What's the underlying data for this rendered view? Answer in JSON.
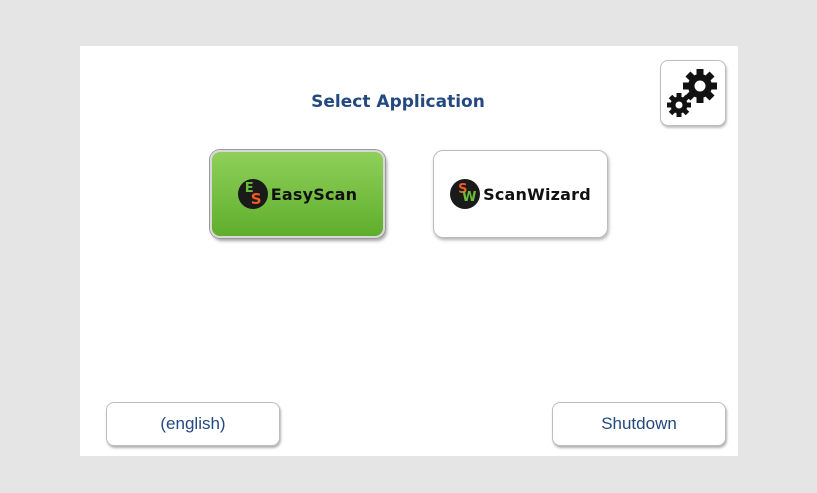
{
  "header": {
    "title": "Select Application"
  },
  "settings": {
    "icon": "gears-icon"
  },
  "apps": [
    {
      "label": "EasyScan",
      "logo_letters": [
        "E",
        "S"
      ],
      "selected": true
    },
    {
      "label": "ScanWizard",
      "logo_letters": [
        "S",
        "W"
      ],
      "selected": false
    }
  ],
  "footer": {
    "language_label": "(english)",
    "shutdown_label": "Shutdown"
  },
  "colors": {
    "title": "#23497f",
    "selected_app": "#6fbf3a",
    "logo_green": "#6abf3a",
    "logo_orange": "#f05a23"
  }
}
